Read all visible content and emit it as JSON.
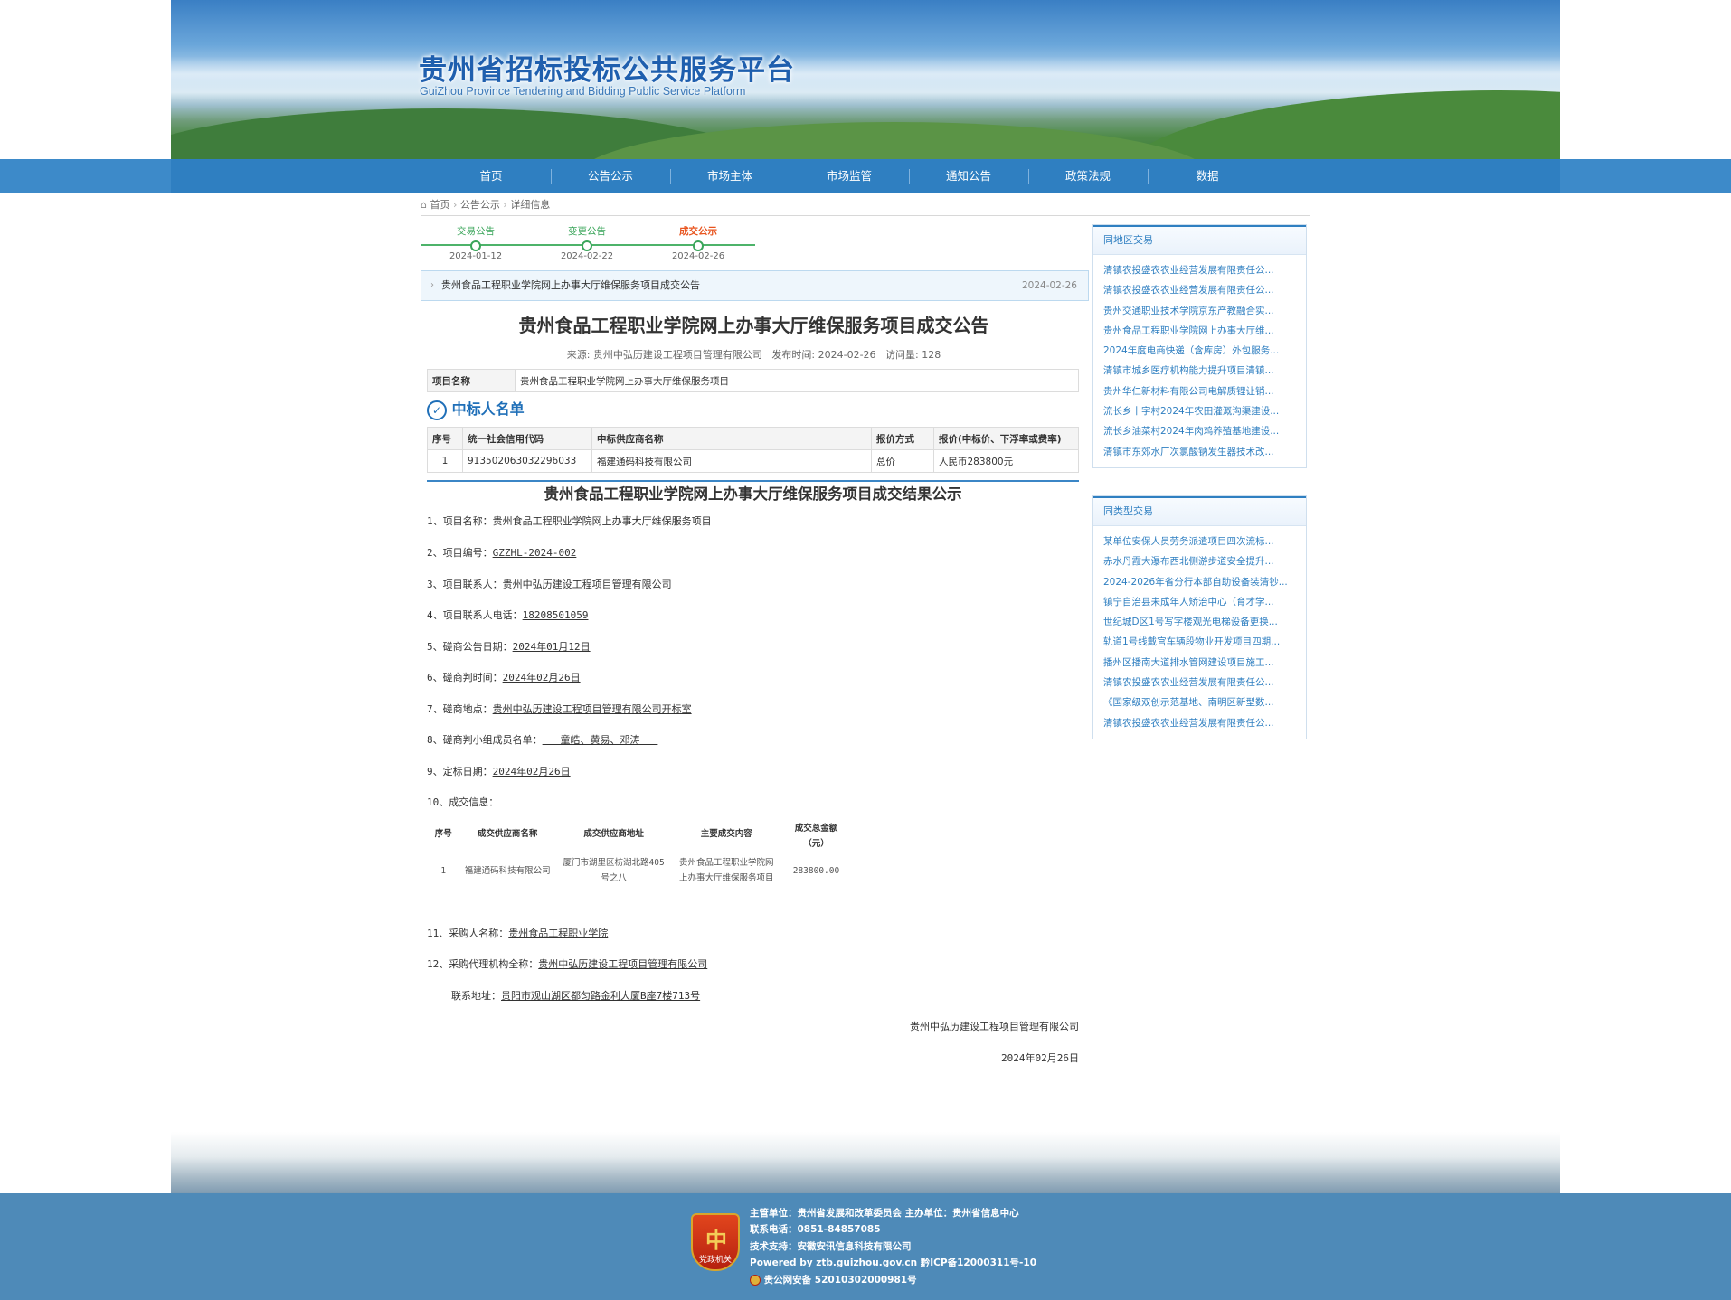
{
  "header": {
    "title": "贵州省招标投标公共服务平台",
    "subtitle": "GuiZhou Province Tendering and Bidding Public Service Platform"
  },
  "nav": [
    "首页",
    "公告公示",
    "市场主体",
    "市场监管",
    "通知公告",
    "政策法规",
    "数据"
  ],
  "breadcrumb": {
    "home": "首页",
    "section": "公告公示",
    "current": "详细信息"
  },
  "timeline": [
    {
      "label": "交易公告",
      "date": "2024-01-12",
      "active": false
    },
    {
      "label": "变更公告",
      "date": "2024-02-22",
      "active": false
    },
    {
      "label": "成交公示",
      "date": "2024-02-26",
      "active": true
    }
  ],
  "notice": {
    "text": "贵州食品工程职业学院网上办事大厅维保服务项目成交公告",
    "date": "2024-02-26"
  },
  "article": {
    "title": "贵州食品工程职业学院网上办事大厅维保服务项目成交公告",
    "meta": "来源: 贵州中弘历建设工程项目管理有限公司   发布时间: 2024-02-26   访问量: 128",
    "project_label": "项目名称",
    "project_value": "贵州食品工程职业学院网上办事大厅维保服务项目",
    "winner_heading": "中标人名单",
    "winner_headers": [
      "序号",
      "统一社会信用代码",
      "中标供应商名称",
      "报价方式",
      "报价(中标价、下浮率或费率)"
    ],
    "winner_row": [
      "1",
      "91350206303229603​3",
      "福建通码科技有限公司",
      "总价",
      "人民币283800元"
    ],
    "content_title": "贵州食品工程职业学院网上办事大厅维保服务项目成交结果公示",
    "items": {
      "i1_label": "1、项目名称：",
      "i1_value": "贵州食品工程职业学院网上办事大厅维保服务项目",
      "i2_label": "2、项目编号：",
      "i2_value": "GZZHL-2024-002",
      "i3_label": "3、项目联系人：",
      "i3_value": "贵州中弘历建设工程项目管理有限公司",
      "i4_label": "4、项目联系人电话：",
      "i4_value": "18208501059",
      "i5_label": "5、磋商公告日期：",
      "i5_value": "2024年01月12日",
      "i6_label": "6、磋商判时间：",
      "i6_value": "2024年02月26日",
      "i7_label": "7、磋商地点：",
      "i7_value": "贵州中弘历建设工程项目管理有限公司开标室",
      "i8_label": "8、磋商判小组成员名单：",
      "i8_value": "   童皓、黄易、邓涛   ",
      "i9_label": "9、定标日期：",
      "i9_value": "2024年02月26日",
      "i10_label": "10、成交信息：",
      "i11_label": "11、采购人名称：",
      "i11_value": "贵州食品工程职业学院",
      "i12_label": "12、采购代理机构全称：",
      "i12_value": "贵州中弘历建设工程项目管理有限公司",
      "addr_label": "联系地址：",
      "addr_value": "贵阳市观山湖区都匀路金利大厦B座7楼713号"
    },
    "result_headers": [
      "序号",
      "成交供应商名称",
      "成交供应商地址",
      "主要成交内容",
      "成交总金额（元）"
    ],
    "result_row": [
      "1",
      "福建通码科技有限公司",
      "厦门市湖里区枋湖北路405号之八",
      "贵州食品工程职业学院网上办事大厅维保服务项目",
      "283800.00"
    ],
    "signature": "贵州中弘历建设工程项目管理有限公司",
    "sign_date": "2024年02月26日"
  },
  "sidebar": {
    "local_title": "同地区交易",
    "local_items": [
      "清镇农投盛农农业经营发展有限责任公...",
      "清镇农投盛农农业经营发展有限责任公...",
      "贵州交通职业技术学院京东产教融合实...",
      "贵州食品工程职业学院网上办事大厅维...",
      "2024年度电商快递（含库房）外包服务...",
      "清镇市城乡医疗机构能力提升项目清镇...",
      "贵州华仁新材料有限公司电解质锂让销...",
      "流长乡十字村2024年农田灌溉沟渠建设...",
      "流长乡油菜村2024年肉鸡养殖基地建设...",
      "清镇市东郊水厂次氯酸钠发生器技术改..."
    ],
    "similar_title": "同类型交易",
    "similar_items": [
      "某单位安保人员劳务派遣项目四次流标...",
      "赤水丹霞大瀑布西北侧游步道安全提升...",
      "2024-2026年省分行本部自助设备装清钞...",
      "镇宁自治县未成年人矫治中心（育才学...",
      "世纪城D区1号写字楼观光电梯设备更换...",
      "轨道1号线戴官车辆段物业开发项目四期...",
      "播州区播南大道排水管网建设项目施工...",
      "清镇农投盛农农业经营发展有限责任公...",
      "《国家级双创示范基地、南明区新型数...",
      "清镇农投盛农农业经营发展有限责任公..."
    ]
  },
  "footer": {
    "line1": "主管单位：贵州省发展和改革委员会   主办单位：贵州省信息中心",
    "line2": "联系电话：0851-84857085",
    "line3": "技术支持：安徽安讯信息科技有限公司",
    "line4": "Powered by ztb.guizhou.gov.cn  黔ICP备12000311号-10",
    "line5": "贵公网安备 52010302000981号",
    "badge": "党政机关"
  },
  "colors": {
    "primary": "#2f7fc1",
    "nav": "#2f7fc1",
    "footer": "#4e8ab8",
    "timeline": "#3aa55a",
    "active": "#e8541e"
  }
}
